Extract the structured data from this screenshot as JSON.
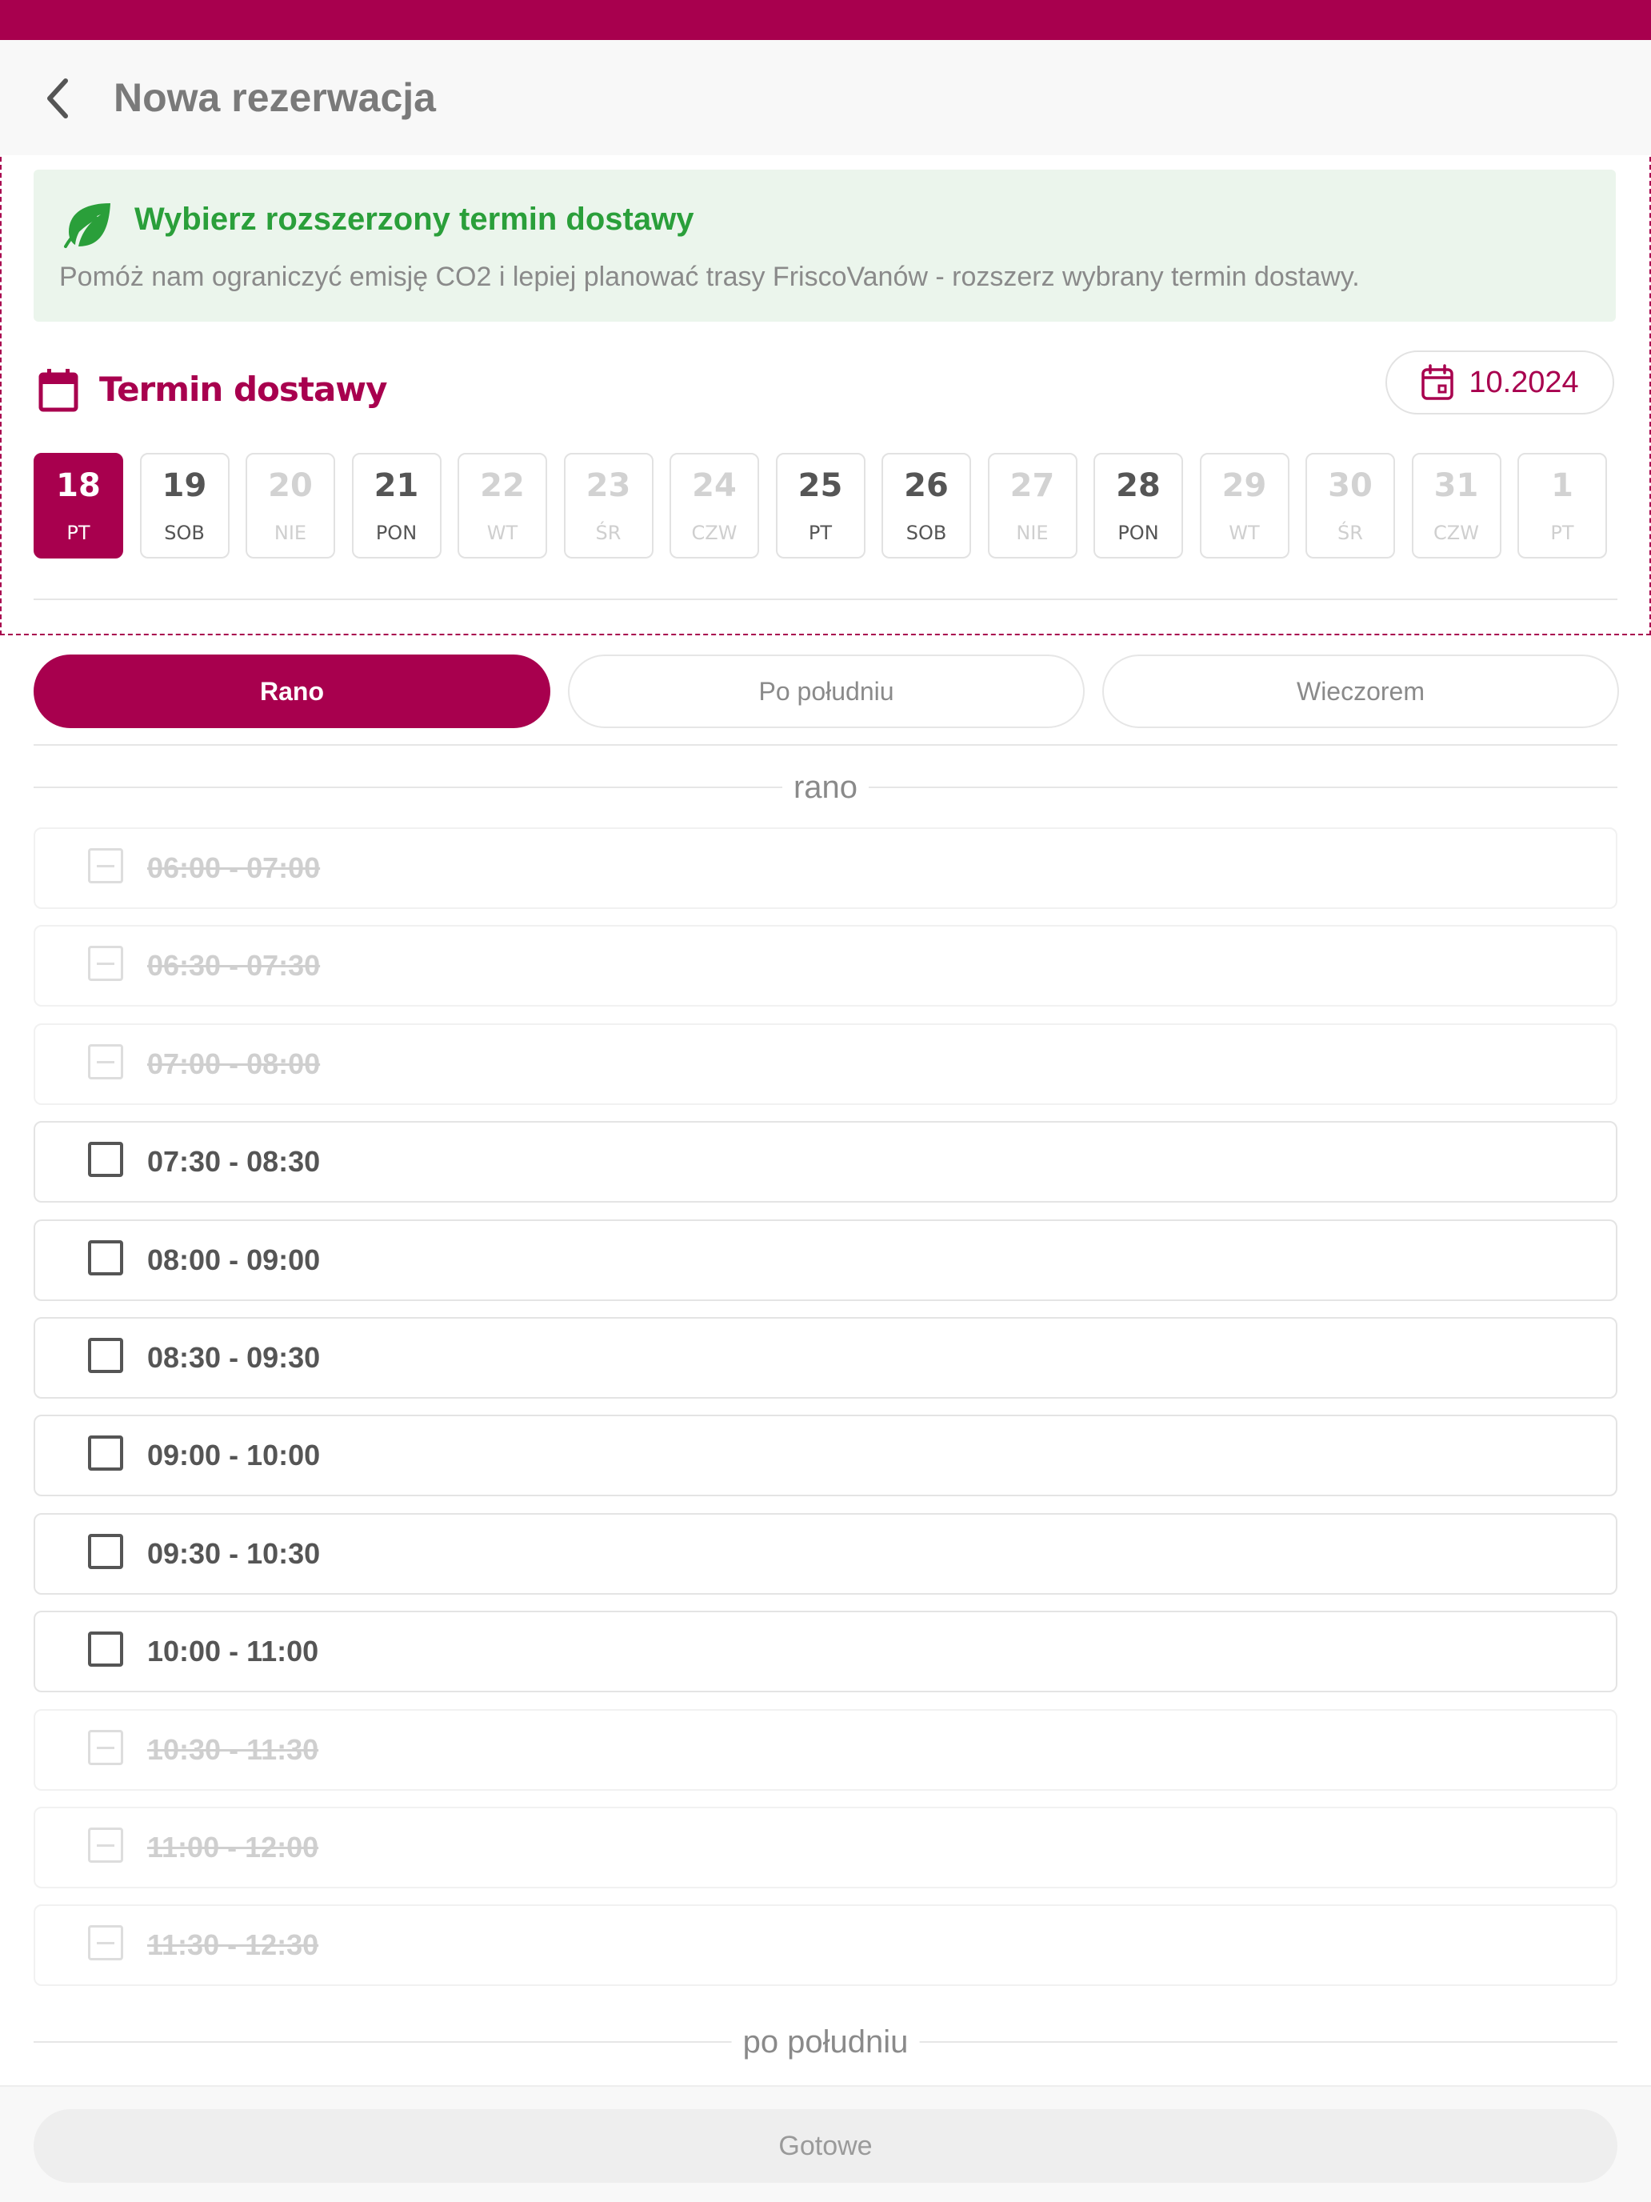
{
  "header": {
    "title": "Nowa rezerwacja"
  },
  "eco_banner": {
    "title": "Wybierz rozszerzony termin dostawy",
    "text": "Pomóż nam ograniczyć emisję CO2 i lepiej planować trasy FriscoVanów - rozszerz wybrany termin dostawy."
  },
  "delivery": {
    "section_title": "Termin dostawy",
    "month_label": "10.2024"
  },
  "days": [
    {
      "num": "18",
      "weekday": "PT",
      "state": "selected"
    },
    {
      "num": "19",
      "weekday": "SOB",
      "state": "available"
    },
    {
      "num": "20",
      "weekday": "NIE",
      "state": "disabled"
    },
    {
      "num": "21",
      "weekday": "PON",
      "state": "available"
    },
    {
      "num": "22",
      "weekday": "WT",
      "state": "disabled"
    },
    {
      "num": "23",
      "weekday": "ŚR",
      "state": "disabled"
    },
    {
      "num": "24",
      "weekday": "CZW",
      "state": "disabled"
    },
    {
      "num": "25",
      "weekday": "PT",
      "state": "available"
    },
    {
      "num": "26",
      "weekday": "SOB",
      "state": "available"
    },
    {
      "num": "27",
      "weekday": "NIE",
      "state": "disabled"
    },
    {
      "num": "28",
      "weekday": "PON",
      "state": "available"
    },
    {
      "num": "29",
      "weekday": "WT",
      "state": "disabled"
    },
    {
      "num": "30",
      "weekday": "ŚR",
      "state": "disabled"
    },
    {
      "num": "31",
      "weekday": "CZW",
      "state": "disabled"
    },
    {
      "num": "1",
      "weekday": "PT",
      "state": "disabled"
    }
  ],
  "tabs": [
    {
      "label": "Rano",
      "active": true
    },
    {
      "label": "Po południu",
      "active": false
    },
    {
      "label": "Wieczorem",
      "active": false
    }
  ],
  "groups": {
    "morning": "rano",
    "afternoon": "po południu"
  },
  "slots": [
    {
      "time": "06:00 - 07:00",
      "available": false
    },
    {
      "time": "06:30 - 07:30",
      "available": false
    },
    {
      "time": "07:00 - 08:00",
      "available": false
    },
    {
      "time": "07:30 - 08:30",
      "available": true
    },
    {
      "time": "08:00 - 09:00",
      "available": true
    },
    {
      "time": "08:30 - 09:30",
      "available": true
    },
    {
      "time": "09:00 - 10:00",
      "available": true
    },
    {
      "time": "09:30 - 10:30",
      "available": true
    },
    {
      "time": "10:00 - 11:00",
      "available": true
    },
    {
      "time": "10:30 - 11:30",
      "available": false
    },
    {
      "time": "11:00 - 12:00",
      "available": false
    },
    {
      "time": "11:30 - 12:30",
      "available": false
    }
  ],
  "footer": {
    "done_label": "Gotowe"
  },
  "colors": {
    "brand": "#a8004e",
    "eco_green": "#2a9f3a",
    "eco_bg": "#ebf5ec"
  },
  "icons": {
    "back": "chevron-left-icon",
    "leaf": "leaf-icon",
    "calendar": "calendar-icon",
    "month_picker": "calendar-date-icon"
  }
}
